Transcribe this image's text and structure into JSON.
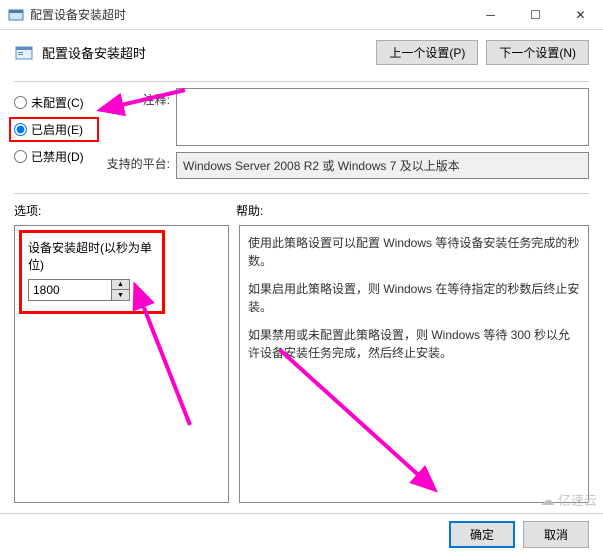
{
  "window": {
    "title": "配置设备安装超时"
  },
  "subtitle": "配置设备安装超时",
  "nav": {
    "prev": "上一个设置(P)",
    "next": "下一个设置(N)"
  },
  "radios": {
    "not_configured": "未配置(C)",
    "enabled": "已启用(E)",
    "disabled": "已禁用(D)",
    "selected": "enabled"
  },
  "comment": {
    "label": "注释:",
    "value": ""
  },
  "platform": {
    "label": "支持的平台:",
    "value": "Windows Server 2008 R2 或 Windows 7 及以上版本"
  },
  "sections": {
    "options": "选项:",
    "help": "帮助:"
  },
  "option": {
    "label": "设备安装超时(以秒为单位)",
    "value": "1800"
  },
  "help": {
    "p1": "使用此策略设置可以配置 Windows 等待设备安装任务完成的秒数。",
    "p2": "如果启用此策略设置，则 Windows 在等待指定的秒数后终止安装。",
    "p3": "如果禁用或未配置此策略设置，则 Windows 等待 300 秒以允许设备安装任务完成，然后终止安装。"
  },
  "footer": {
    "ok": "确定",
    "cancel": "取消"
  },
  "watermark": "亿速云"
}
